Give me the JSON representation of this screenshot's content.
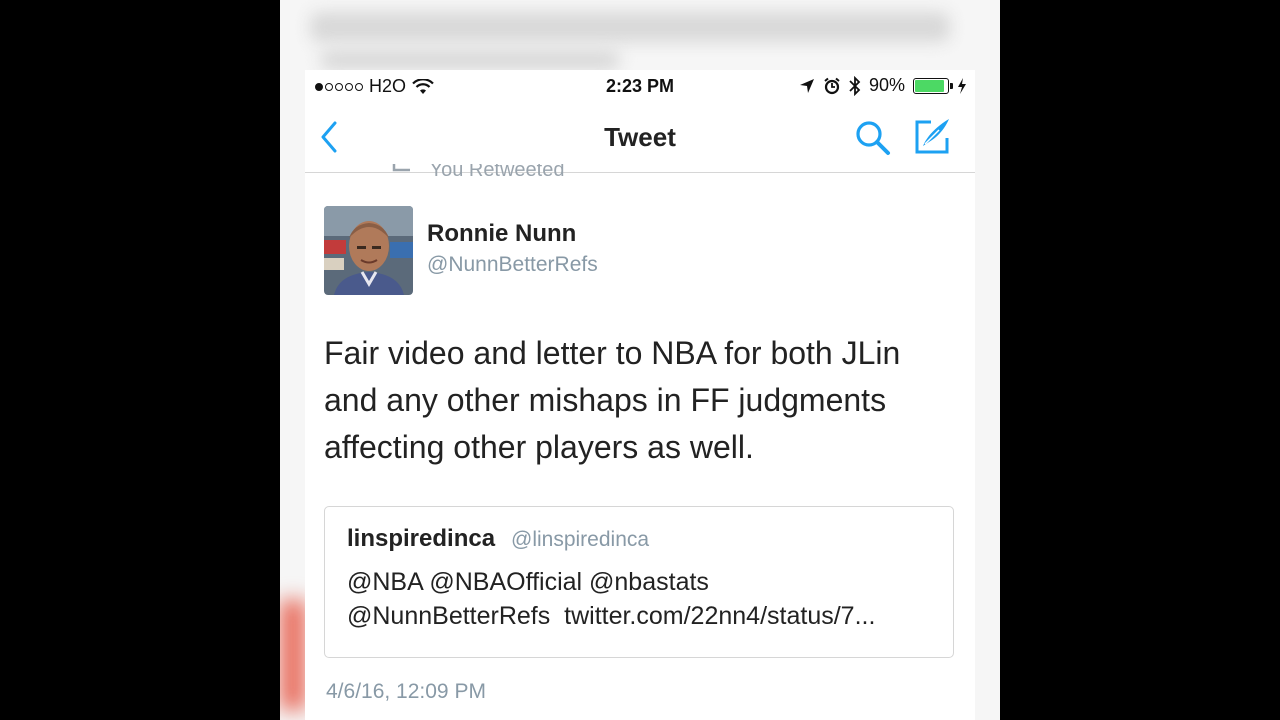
{
  "status_bar": {
    "carrier": "H2O",
    "time": "2:23 PM",
    "battery_percent": "90%",
    "signal_bars_filled": 1,
    "signal_bars_total": 5,
    "battery_level": 0.9,
    "battery_color": "#4cd964"
  },
  "nav": {
    "title": "Tweet",
    "back_icon": "chevron-left-icon",
    "search_icon": "search-icon",
    "compose_icon": "compose-icon",
    "accent_color": "#1da1f2"
  },
  "tweet": {
    "retweeted_label": "You Retweeted",
    "author_name": "Ronnie Nunn",
    "author_handle": "@NunnBetterRefs",
    "text": "Fair video and letter to NBA for both JLin and any other mishaps in FF judgments affecting other players as well.",
    "timestamp": "4/6/16, 12:09 PM"
  },
  "quoted_tweet": {
    "author_name": "linspiredinca",
    "author_handle": "@linspiredinca",
    "text_line1": "@NBA @NBAOfficial @nbastats",
    "text_line2": "@NunnBetterRefs  twitter.com/22nn4/status/7..."
  }
}
